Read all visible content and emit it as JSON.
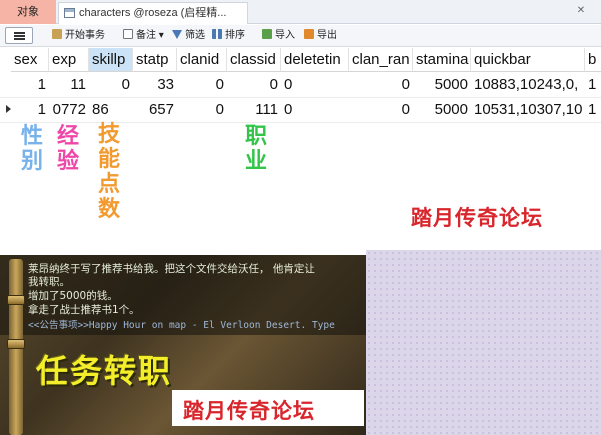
{
  "tabs": {
    "objects_label": "对象",
    "table_tab_label": "characters @roseza (启程精..."
  },
  "toolbar": {
    "begin_transaction": "开始事务",
    "notes": "备注",
    "filter": "筛选",
    "sort": "排序",
    "import": "导入",
    "export": "导出"
  },
  "grid": {
    "columns": [
      "sex",
      "exp",
      "skillp",
      "statp",
      "clanid",
      "classid",
      "deletetin",
      "clan_ran",
      "stamina",
      "quickbar",
      "b"
    ],
    "rows": [
      [
        "1",
        "11",
        "0",
        "33",
        "0",
        "0",
        "0",
        "0",
        "5000",
        "10883,10243,0,",
        "1"
      ],
      [
        "1",
        "0772",
        "86",
        "657",
        "0",
        "111",
        "0",
        "0",
        "5000",
        "10531,10307,10",
        "1"
      ]
    ]
  },
  "annotations": {
    "sex": "性别",
    "exp": "经验",
    "skill_points": "技能点数",
    "class": "职业"
  },
  "watermark": "踏月传奇论坛",
  "game": {
    "chat": [
      "莱昂纳终于写了推荐书给我。把这个文件交给沃任， 他肯定让",
      "我转职。",
      "增加了5000的钱。",
      "拿走了战士推荐书1个。",
      "<<公告事项>>Happy Hour on map - El Verloon Desert. Type"
    ],
    "title": "任务转职"
  },
  "colors": {
    "annotation_sex": "#77b2ea",
    "annotation_exp": "#ee47a8",
    "annotation_skill": "#f39a2f",
    "annotation_class": "#33c44a",
    "watermark": "#d8262c",
    "quest_title": "#f4ed2a",
    "selected_column": "#cce3f7"
  },
  "icons": [
    "menu-icon",
    "transaction-icon",
    "notes-icon",
    "filter-icon",
    "sort-icon",
    "import-icon",
    "export-icon",
    "table-icon",
    "close-icon"
  ]
}
